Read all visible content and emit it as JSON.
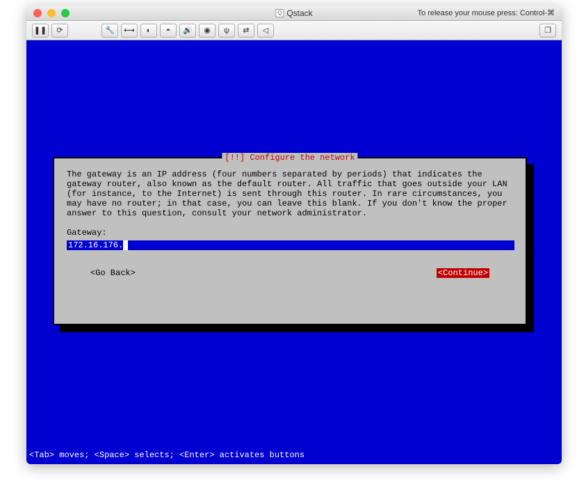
{
  "window": {
    "title": "Qstack",
    "mouse_release_hint": "To release your mouse press: Control-⌘"
  },
  "dialog": {
    "title": "[!!] Configure the network",
    "description": "The gateway is an IP address (four numbers separated by periods) that indicates the gateway router, also known as the default router.  All traffic that goes outside your LAN (for instance, to the Internet) is sent through this router.  In rare circumstances, you may have no router; in that case, you can leave this blank.  If you don't know the proper answer to this question, consult your network administrator.",
    "field_label": "Gateway:",
    "field_value": "172.16.176.",
    "go_back_label": "<Go Back>",
    "continue_label": "<Continue>"
  },
  "footer": {
    "hint": "<Tab> moves; <Space> selects; <Enter> activates buttons"
  }
}
